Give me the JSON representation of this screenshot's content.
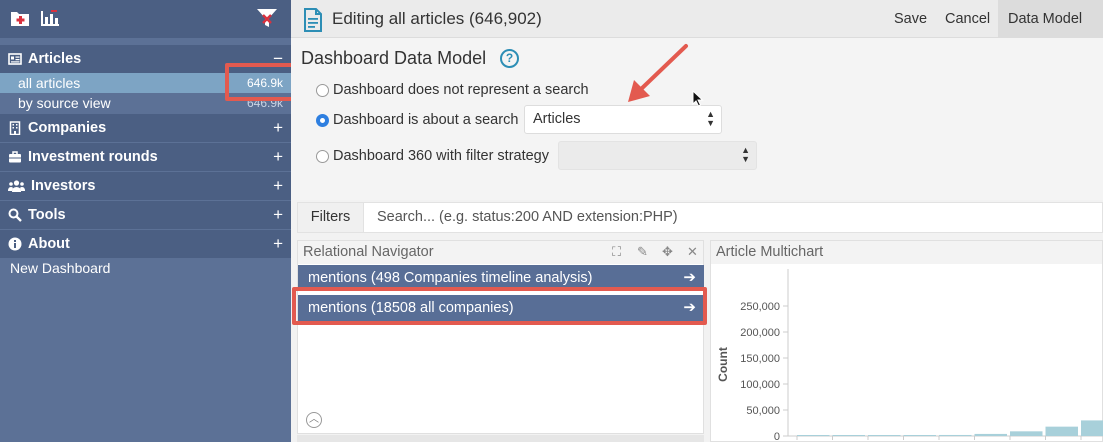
{
  "sidebar": {
    "toolbar_icons": [
      "add-dashboard-icon",
      "add-chart-icon",
      "filter-remove-icon"
    ],
    "sections": [
      {
        "label": "Articles",
        "icon": "newspaper-icon",
        "toggle": "−",
        "items": [
          {
            "label": "all articles",
            "count": "646.9k",
            "active": true
          },
          {
            "label": "by source view",
            "count": "646.9k",
            "active": false
          }
        ]
      },
      {
        "label": "Companies",
        "icon": "building-icon",
        "toggle": "+"
      },
      {
        "label": "Investment rounds",
        "icon": "briefcase-icon",
        "toggle": "+"
      },
      {
        "label": "Investors",
        "icon": "users-icon",
        "toggle": "+"
      },
      {
        "label": "Tools",
        "icon": "search-icon",
        "toggle": "+"
      },
      {
        "label": "About",
        "icon": "info-icon",
        "toggle": "+"
      }
    ],
    "new_dashboard": "New Dashboard"
  },
  "header": {
    "title": "Editing all articles (646,902)",
    "save": "Save",
    "cancel": "Cancel",
    "data_model": "Data Model"
  },
  "data_model": {
    "title": "Dashboard Data Model",
    "help": "?",
    "options": [
      {
        "label": "Dashboard does not represent a search",
        "selected": false
      },
      {
        "label": "Dashboard is about a search",
        "selected": true,
        "select_value": "Articles"
      },
      {
        "label": "Dashboard 360 with filter strategy",
        "selected": false,
        "select_value": ""
      }
    ]
  },
  "filters": {
    "label": "Filters",
    "placeholder": "Search... (e.g. status:200 AND extension:PHP)"
  },
  "relational_navigator": {
    "title": "Relational Navigator",
    "rows": [
      {
        "label": "mentions (498 Companies timeline analysis)"
      },
      {
        "label": "mentions (18508 all companies)"
      }
    ]
  },
  "multichart": {
    "title": "Article Multichart"
  },
  "chart_data": {
    "type": "bar",
    "title": "",
    "xlabel": "",
    "ylabel": "Count",
    "ylim": [
      0,
      275000
    ],
    "yticks": [
      "0",
      "50,000",
      "100,000",
      "150,000",
      "200,000",
      "250,000"
    ],
    "values": [
      200,
      300,
      500,
      900,
      2000,
      4000,
      9000,
      18000,
      30000,
      37000
    ]
  },
  "colors": {
    "sidebar": "#5c7196",
    "active_item": "#7da4c4",
    "nav_row": "#586e96",
    "highlight": "#e35a4f",
    "bar": "#a8d0da"
  }
}
